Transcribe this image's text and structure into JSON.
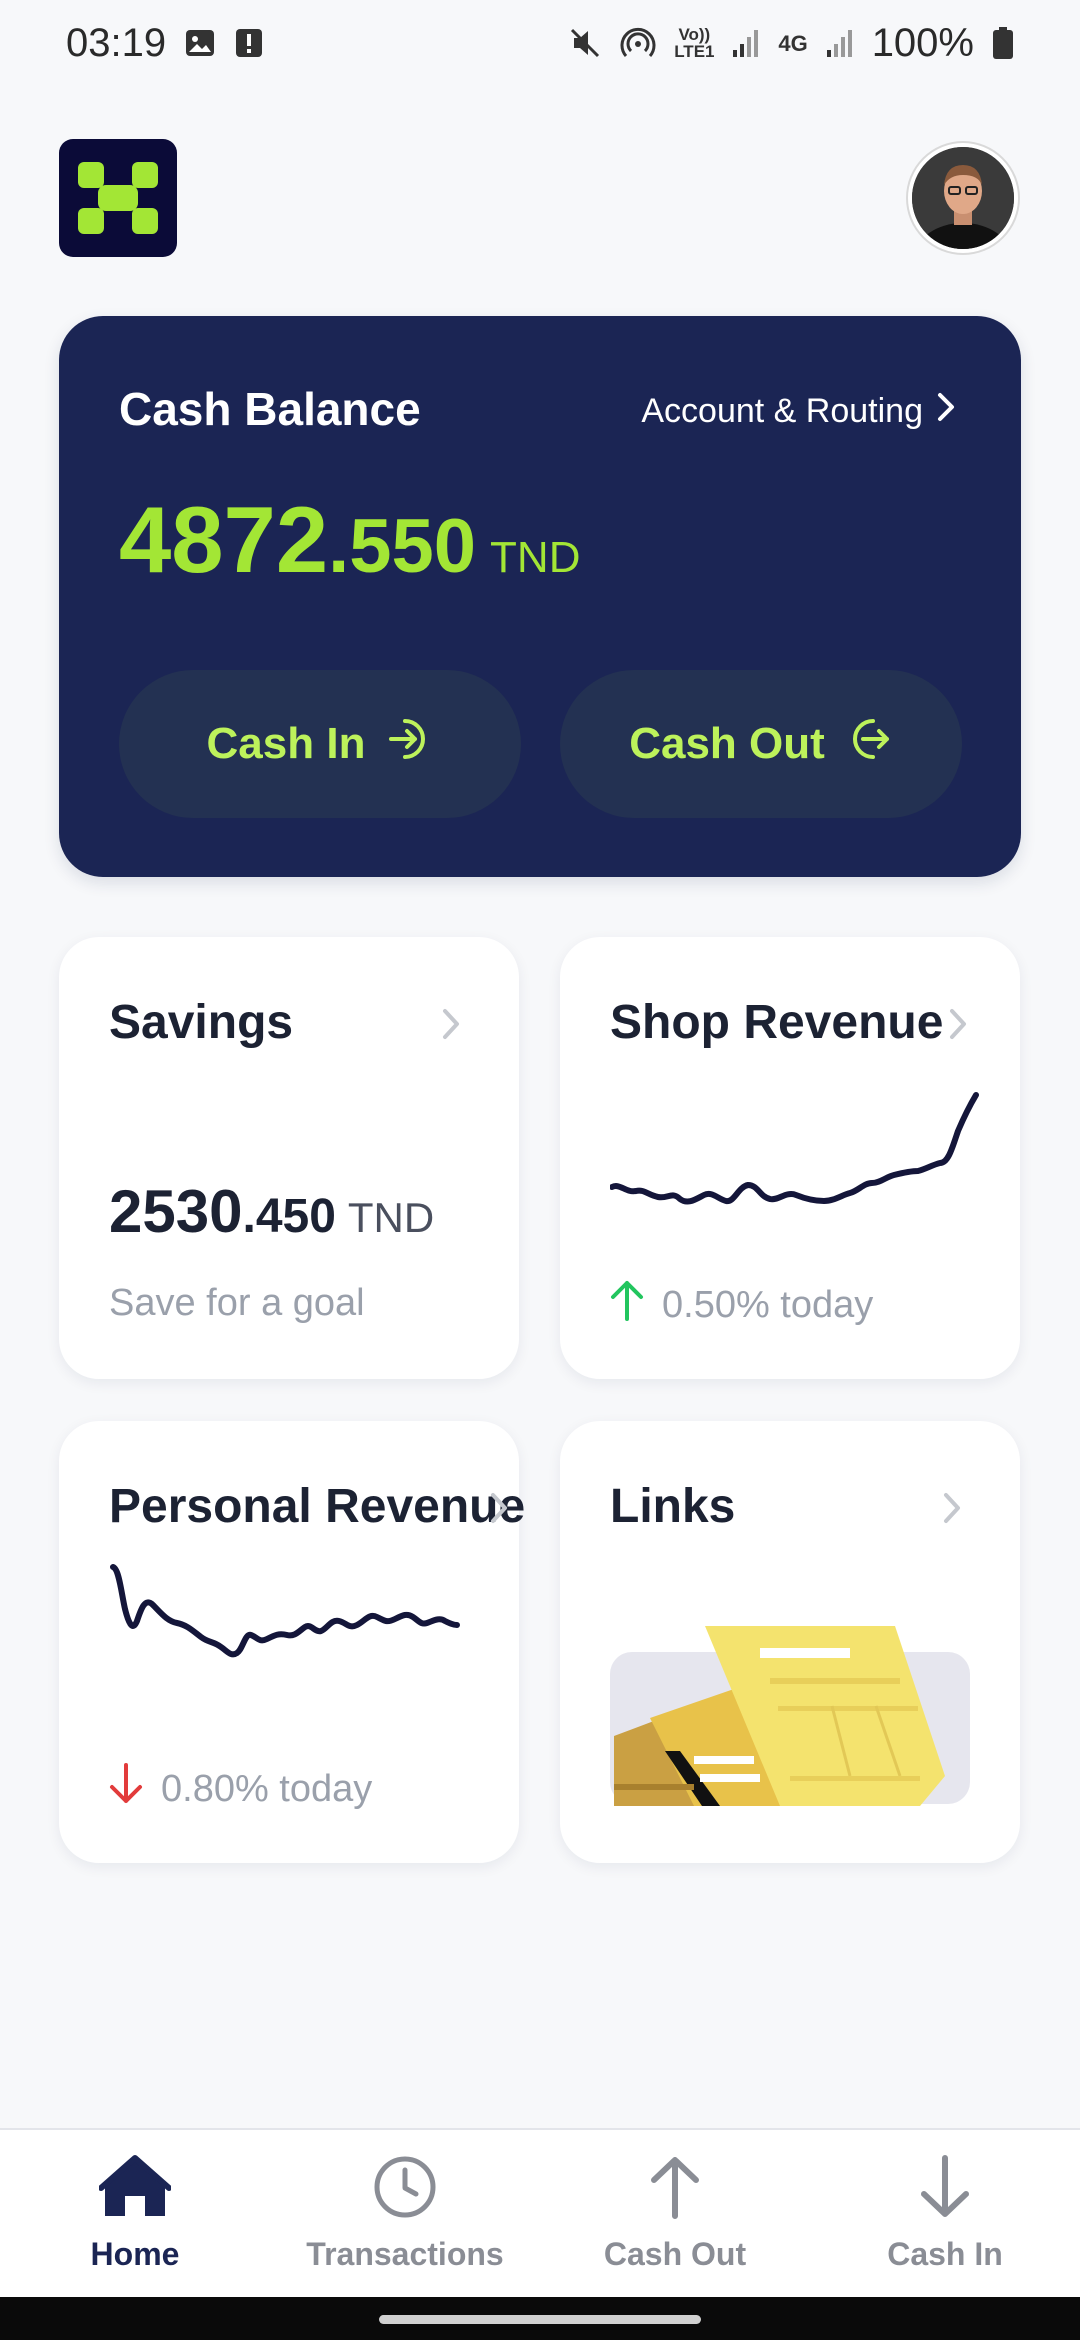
{
  "status_bar": {
    "time": "03:19",
    "battery": "100%",
    "volte_label": "Vo)) LTE1",
    "network_label": "4G",
    "icons": [
      "image-icon",
      "alert-icon",
      "mute-icon",
      "hotspot-icon",
      "signal-icon",
      "battery-icon"
    ]
  },
  "header": {
    "logo_icon": "app-logo-icon",
    "avatar_icon": "user-avatar"
  },
  "balance_card": {
    "title": "Cash Balance",
    "routing_label": "Account & Routing",
    "amount_int": "4872",
    "amount_dec": ".550",
    "currency": "TND",
    "cash_in_label": "Cash In",
    "cash_out_label": "Cash Out"
  },
  "tiles": {
    "savings": {
      "title": "Savings",
      "amount_int": "2530",
      "amount_dec": ".450",
      "currency": "TND",
      "subtitle": "Save for a goal"
    },
    "shop": {
      "title": "Shop Revenue",
      "trend": "0.50% today",
      "trend_direction": "up"
    },
    "personal": {
      "title": "Personal Revenue",
      "trend": "0.80% today",
      "trend_direction": "down"
    },
    "links": {
      "title": "Links"
    }
  },
  "bottom_nav": {
    "items": [
      {
        "label": "Home",
        "icon": "home-icon",
        "active": true
      },
      {
        "label": "Transactions",
        "icon": "clock-icon",
        "active": false
      },
      {
        "label": "Cash Out",
        "icon": "arrow-up-icon",
        "active": false
      },
      {
        "label": "Cash In",
        "icon": "arrow-down-icon",
        "active": false
      }
    ]
  },
  "colors": {
    "accent": "#a3e635",
    "navy": "#1b2554",
    "up": "#22c55e",
    "down": "#e23b3b"
  }
}
